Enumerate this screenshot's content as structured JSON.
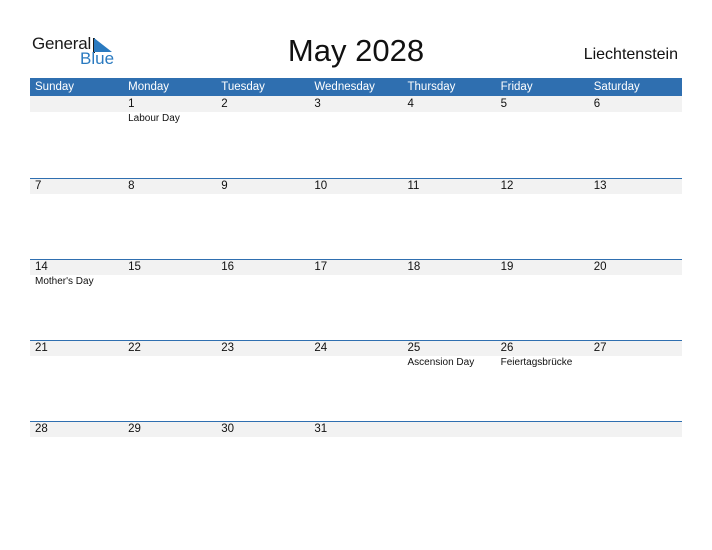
{
  "logo": {
    "line1": "General",
    "line2": "Blue"
  },
  "title": "May 2028",
  "country": "Liechtenstein",
  "colors": {
    "header_bg": "#2f6fb0",
    "date_strip": "#f2f2f2",
    "logo_blue": "#2a7ac0"
  },
  "weekdays": [
    "Sunday",
    "Monday",
    "Tuesday",
    "Wednesday",
    "Thursday",
    "Friday",
    "Saturday"
  ],
  "weeks": [
    [
      {
        "day": "",
        "holiday": ""
      },
      {
        "day": "1",
        "holiday": "Labour Day"
      },
      {
        "day": "2",
        "holiday": ""
      },
      {
        "day": "3",
        "holiday": ""
      },
      {
        "day": "4",
        "holiday": ""
      },
      {
        "day": "5",
        "holiday": ""
      },
      {
        "day": "6",
        "holiday": ""
      }
    ],
    [
      {
        "day": "7",
        "holiday": ""
      },
      {
        "day": "8",
        "holiday": ""
      },
      {
        "day": "9",
        "holiday": ""
      },
      {
        "day": "10",
        "holiday": ""
      },
      {
        "day": "11",
        "holiday": ""
      },
      {
        "day": "12",
        "holiday": ""
      },
      {
        "day": "13",
        "holiday": ""
      }
    ],
    [
      {
        "day": "14",
        "holiday": "Mother's Day"
      },
      {
        "day": "15",
        "holiday": ""
      },
      {
        "day": "16",
        "holiday": ""
      },
      {
        "day": "17",
        "holiday": ""
      },
      {
        "day": "18",
        "holiday": ""
      },
      {
        "day": "19",
        "holiday": ""
      },
      {
        "day": "20",
        "holiday": ""
      }
    ],
    [
      {
        "day": "21",
        "holiday": ""
      },
      {
        "day": "22",
        "holiday": ""
      },
      {
        "day": "23",
        "holiday": ""
      },
      {
        "day": "24",
        "holiday": ""
      },
      {
        "day": "25",
        "holiday": "Ascension Day"
      },
      {
        "day": "26",
        "holiday": "Feiertagsbrücke"
      },
      {
        "day": "27",
        "holiday": ""
      }
    ],
    [
      {
        "day": "28",
        "holiday": ""
      },
      {
        "day": "29",
        "holiday": ""
      },
      {
        "day": "30",
        "holiday": ""
      },
      {
        "day": "31",
        "holiday": ""
      },
      {
        "day": "",
        "holiday": ""
      },
      {
        "day": "",
        "holiday": ""
      },
      {
        "day": "",
        "holiday": ""
      }
    ]
  ]
}
